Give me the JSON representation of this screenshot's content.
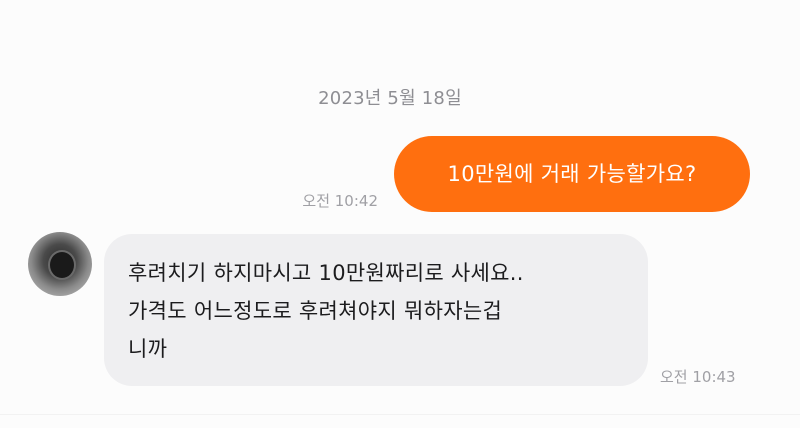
{
  "conversation": {
    "date_divider": "2023년 5월 18일",
    "messages": [
      {
        "direction": "outgoing",
        "text": "10만원에 거래 가능할가요?",
        "time": "오전 10:42"
      },
      {
        "direction": "incoming",
        "lines": [
          "후려치기 하지마시고 10만원짜리로 사세요..",
          "가격도 어느정도로 후려쳐야지 뭐하자는겁",
          "니까"
        ],
        "time": "오전 10:43"
      }
    ]
  },
  "colors": {
    "outgoing_bubble": "#ff6f0f",
    "incoming_bubble": "#efeff1",
    "timestamp": "#a0a0a5"
  },
  "icons": {
    "sender_avatar": "avatar"
  }
}
